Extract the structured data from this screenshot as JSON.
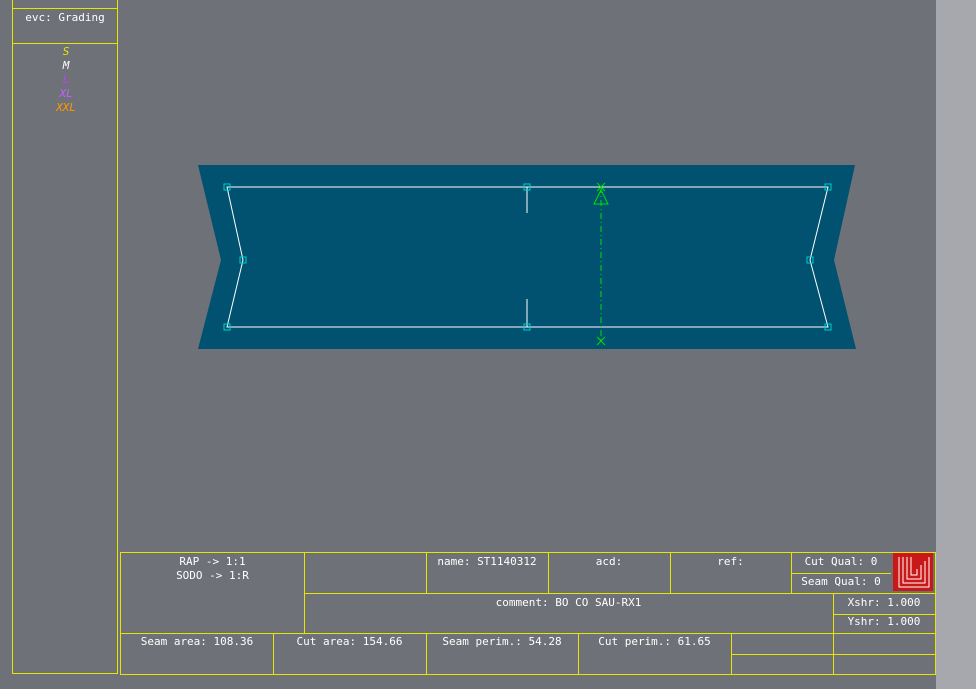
{
  "sidebar": {
    "mode_label": "evc: Grading",
    "sizes": [
      {
        "label": "S",
        "color": "#e6e600"
      },
      {
        "label": "M",
        "color": "#ffffff"
      },
      {
        "label": "L",
        "color": "#c040ff"
      },
      {
        "label": "XL",
        "color": "#c060ff"
      },
      {
        "label": "XXL",
        "color": "#ff9900"
      }
    ]
  },
  "canvas": {
    "background_color": "#6e7178",
    "piece_fill_color": "#005270",
    "seam_line_color": "#ffffff",
    "point_color": "#00d0d0",
    "grainline_color": "#00e000"
  },
  "info": {
    "rap": "RAP -> 1:1",
    "sodo": "SODO -> 1:R",
    "name": "name: ST1140312",
    "acd": "acd:",
    "ref": "ref:",
    "cut_qual": "Cut Qual: 0",
    "seam_qual": "Seam Qual: 0",
    "comment": "comment: BO CO SAU-RX1",
    "xshr": "Xshr: 1.000",
    "yshr": "Yshr: 1.000",
    "seam_area": "Seam area: 108.36",
    "cut_area": "Cut area: 154.66",
    "seam_perim": "Seam perim.: 54.28",
    "cut_perim": "Cut perim.: 61.65",
    "logo_color": "#c81818"
  }
}
